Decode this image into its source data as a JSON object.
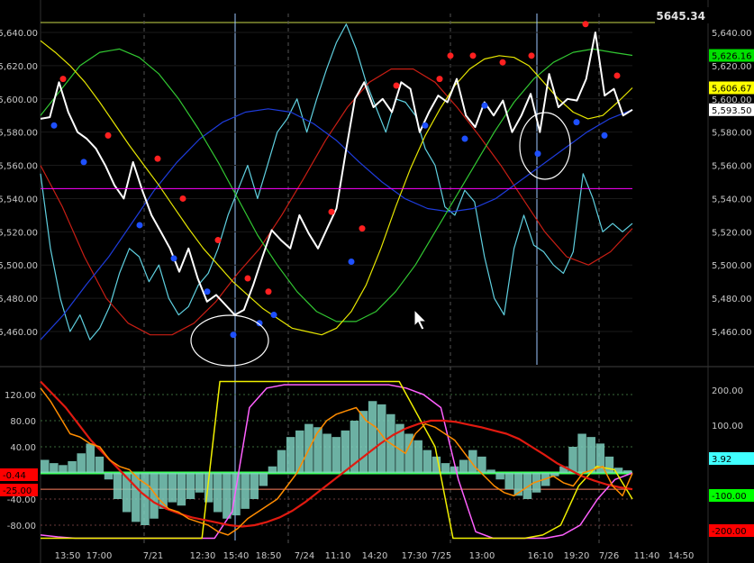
{
  "header": {
    "last_price": "5645.34"
  },
  "colors": {
    "background": "#000000",
    "price": "#ffffff",
    "cyan_line": "#5fd0e0",
    "yellow_line": "#e6e600",
    "green_line": "#32c832",
    "blue_line": "#1e3cdc",
    "red_line": "#c81e14",
    "magenta_line": "#ff00ff",
    "red_dot": "#ff2020",
    "blue_dot": "#1e50ff",
    "osc_histogram": "#7fd0c0",
    "osc_orange": "#ff8c00",
    "osc_red": "#e01a10",
    "osc_yellow": "#f0f000",
    "osc_magenta": "#ff60ff",
    "zero_line": "#40ff60"
  },
  "chart_data": [
    {
      "type": "line",
      "panel": "price",
      "x": [
        "13:50",
        "17:00",
        "7/21",
        "12:30",
        "15:40",
        "18:50",
        "7/24",
        "11:10",
        "14:20",
        "17:30",
        "7/25",
        "13:00",
        "16:10",
        "19:20",
        "7/26",
        "11:40",
        "14:50"
      ],
      "ylim": [
        5440,
        5650
      ],
      "y_ticks": [
        "5,640.00",
        "5,620.00",
        "5,600.00",
        "5,580.00",
        "5,560.00",
        "5,540.00",
        "5,520.00",
        "5,500.00",
        "5,480.00",
        "5,460.00"
      ],
      "price_labels": [
        {
          "text": "5,626.16",
          "color": "#00e000",
          "value": 5626.16
        },
        {
          "text": "5,606.67",
          "color": "#ffff00",
          "value": 5606.67
        },
        {
          "text": "5,593.50",
          "color": "#ffffff",
          "value": 5593.5
        }
      ],
      "series": [
        {
          "key": "price",
          "values": [
            5588,
            5589,
            5610,
            5592,
            5580,
            5576,
            5570,
            5560,
            5548,
            5540,
            5562,
            5545,
            5530,
            5520,
            5510,
            5496,
            5510,
            5492,
            5478,
            5482,
            5476,
            5470,
            5473,
            5488,
            5505,
            5521,
            5515,
            5510,
            5530,
            5519,
            5510,
            5522,
            5534,
            5568,
            5600,
            5610,
            5595,
            5600,
            5592,
            5610,
            5606,
            5580,
            5592,
            5602,
            5598,
            5612,
            5590,
            5583,
            5598,
            5590,
            5599,
            5580,
            5590,
            5603,
            5580,
            5615,
            5595,
            5600,
            5599,
            5612,
            5640,
            5602,
            5606,
            5590,
            5593.5
          ]
        },
        {
          "key": "cyan",
          "values": [
            5555,
            5510,
            5480,
            5460,
            5470,
            5455,
            5462,
            5475,
            5495,
            5510,
            5505,
            5490,
            5500,
            5480,
            5470,
            5475,
            5488,
            5495,
            5510,
            5530,
            5545,
            5560,
            5540,
            5560,
            5580,
            5588,
            5600,
            5580,
            5600,
            5618,
            5634,
            5645,
            5630,
            5610,
            5595,
            5580,
            5600,
            5598,
            5590,
            5570,
            5560,
            5535,
            5530,
            5545,
            5538,
            5505,
            5480,
            5470,
            5510,
            5530,
            5512,
            5508,
            5500,
            5495,
            5508,
            5555,
            5540,
            5520,
            5525,
            5520,
            5525
          ]
        },
        {
          "key": "yellow",
          "values": [
            5635,
            5628,
            5620,
            5610,
            5598,
            5585,
            5572,
            5560,
            5548,
            5535,
            5522,
            5510,
            5500,
            5490,
            5482,
            5474,
            5468,
            5462,
            5460,
            5458,
            5462,
            5472,
            5488,
            5510,
            5535,
            5558,
            5578,
            5594,
            5608,
            5618,
            5624,
            5626,
            5625,
            5620,
            5610,
            5600,
            5592,
            5588,
            5590,
            5598,
            5606.67
          ]
        },
        {
          "key": "green",
          "values": [
            5590,
            5605,
            5620,
            5628,
            5630,
            5625,
            5615,
            5600,
            5582,
            5562,
            5540,
            5518,
            5500,
            5484,
            5472,
            5466,
            5466,
            5472,
            5484,
            5500,
            5520,
            5540,
            5560,
            5580,
            5598,
            5612,
            5622,
            5628,
            5630,
            5628,
            5626.16
          ]
        },
        {
          "key": "blue",
          "values": [
            5455,
            5470,
            5488,
            5505,
            5525,
            5545,
            5562,
            5576,
            5586,
            5592,
            5594,
            5592,
            5585,
            5575,
            5562,
            5550,
            5540,
            5534,
            5532,
            5534,
            5540,
            5550,
            5560,
            5570,
            5580,
            5588,
            5593.5
          ]
        },
        {
          "key": "red",
          "values": [
            5560,
            5535,
            5505,
            5480,
            5465,
            5458,
            5458,
            5465,
            5478,
            5495,
            5510,
            5530,
            5552,
            5575,
            5595,
            5610,
            5618,
            5618,
            5610,
            5595,
            5578,
            5560,
            5540,
            5520,
            5505,
            5500,
            5508,
            5522
          ]
        }
      ],
      "hline": 5546,
      "red_dots": [
        5612,
        5578,
        5564,
        5540,
        5515,
        5492,
        5484,
        5532,
        5522,
        5608,
        5612,
        5626,
        5626,
        5622,
        5626,
        5645,
        5614
      ],
      "blue_dots": [
        5584,
        5562,
        5524,
        5504,
        5484,
        5458,
        5465,
        5470,
        5502,
        5584,
        5576,
        5596,
        5567,
        5586,
        5578
      ]
    },
    {
      "type": "line",
      "panel": "oscillator",
      "ylim_left": [
        -110,
        140
      ],
      "y_ticks_left": [
        "120.00",
        "80.00",
        "40.00",
        "-40.00",
        "-80.00"
      ],
      "y_ticks_right": [
        "200.00",
        "100.00"
      ],
      "value_labels_left": [
        {
          "text": "-0.44",
          "color": "#ff0000",
          "value": -0.44
        },
        {
          "text": "-25.00",
          "color": "#ff0000",
          "value": -25
        }
      ],
      "value_labels_right": [
        {
          "text": "3.92",
          "color": "#40ffff",
          "value": 3.92
        },
        {
          "text": "-100.00",
          "color": "#00ff00",
          "value": -100
        },
        {
          "text": "-200.00",
          "color": "#ff0000",
          "value": -200
        }
      ],
      "series": [
        {
          "key": "histogram",
          "values": [
            20,
            15,
            12,
            18,
            30,
            45,
            25,
            -10,
            -40,
            -60,
            -75,
            -80,
            -70,
            -55,
            -45,
            -50,
            -40,
            -30,
            -45,
            -60,
            -70,
            -65,
            -55,
            -40,
            -20,
            10,
            35,
            55,
            65,
            75,
            70,
            60,
            55,
            65,
            80,
            95,
            110,
            105,
            90,
            75,
            60,
            50,
            35,
            25,
            15,
            10,
            20,
            35,
            25,
            5,
            -10,
            -25,
            -35,
            -40,
            -30,
            -20,
            -5,
            10,
            40,
            60,
            55,
            45,
            25,
            8,
            3.92
          ]
        },
        {
          "key": "orange",
          "values": [
            130,
            110,
            85,
            60,
            55,
            45,
            40,
            20,
            10,
            5,
            -10,
            -20,
            -40,
            -55,
            -60,
            -70,
            -75,
            -80,
            -90,
            -95,
            -85,
            -70,
            -60,
            -50,
            -40,
            -20,
            0,
            30,
            60,
            80,
            90,
            95,
            100,
            80,
            70,
            50,
            40,
            30,
            60,
            75,
            70,
            60,
            50,
            30,
            10,
            -5,
            -20,
            -30,
            -35,
            -25,
            -15,
            -10,
            -5,
            -15,
            -20,
            0,
            5,
            10,
            -20,
            -35,
            -0.44
          ]
        },
        {
          "key": "red",
          "values": [
            140,
            120,
            100,
            75,
            50,
            30,
            10,
            -10,
            -30,
            -45,
            -55,
            -62,
            -68,
            -72,
            -76,
            -80,
            -82,
            -80,
            -75,
            -68,
            -58,
            -45,
            -30,
            -15,
            0,
            15,
            30,
            45,
            58,
            68,
            75,
            80,
            80,
            78,
            74,
            70,
            65,
            60,
            52,
            40,
            28,
            15,
            5,
            -5,
            -12,
            -18,
            -22,
            -25
          ]
        },
        {
          "key": "yellow",
          "values": [
            -100,
            -100,
            -100,
            -100,
            -100,
            -100,
            -100,
            -100,
            -100,
            -100,
            140,
            140,
            140,
            140,
            140,
            140,
            140,
            140,
            140,
            140,
            140,
            90,
            40,
            -100,
            -100,
            -100,
            -100,
            -100,
            -95,
            -80,
            -20,
            10,
            5,
            -40
          ]
        },
        {
          "key": "magenta",
          "values": [
            -95,
            -98,
            -100,
            -100,
            -100,
            -100,
            -100,
            -100,
            -100,
            -100,
            -100,
            -60,
            100,
            130,
            135,
            135,
            135,
            135,
            135,
            135,
            135,
            130,
            120,
            100,
            -10,
            -90,
            -100,
            -100,
            -100,
            -100,
            -95,
            -80,
            -40,
            -10,
            0
          ]
        }
      ]
    }
  ]
}
